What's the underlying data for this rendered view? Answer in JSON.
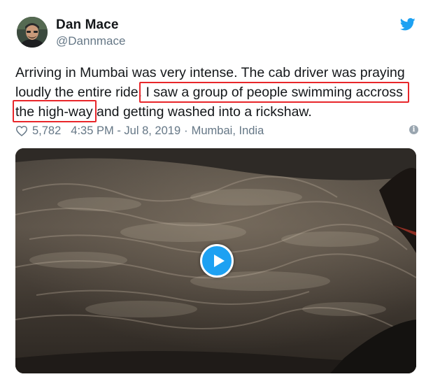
{
  "tweet": {
    "author": {
      "name": "Dan Mace",
      "handle": "@Dannmace",
      "avatar_icon": "profile-photo"
    },
    "text": {
      "line1": "Arriving in Mumbai was very intense. The cab driver was praying",
      "line2_plain": "loudly the entire ride.",
      "line2_highlight": " I saw a group of people swimming accross",
      "line3_highlight": "the high-way",
      "line3_plain": " and getting washed into a rickshaw."
    },
    "likes": "5,782",
    "timestamp": "4:35 PM - Jul 8, 2019",
    "separator": "·",
    "location": "Mumbai, India",
    "icons": {
      "brand": "twitter-bird-icon",
      "like": "heart-icon",
      "info": "info-icon",
      "media": "play-icon"
    },
    "colors": {
      "brand": "#1da1f2",
      "highlight_box": "#e8262a",
      "muted_text": "#657786"
    }
  }
}
